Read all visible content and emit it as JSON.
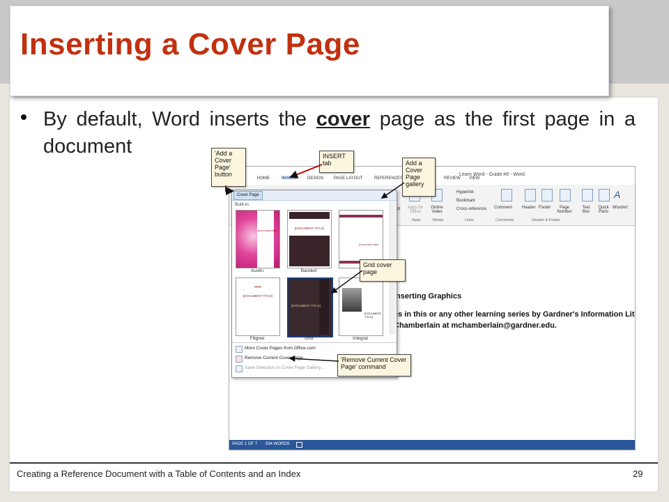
{
  "slide": {
    "title": "Inserting a Cover Page",
    "bullet_before": "By default, Word inserts the ",
    "bullet_emph": "cover",
    "bullet_after": " page as the first page in a document",
    "footer_text": "Creating a Reference Document with a Table of Contents and an Index",
    "page_number": "29"
  },
  "word": {
    "doc_title": "Learn Word - Guide #9 - Word",
    "tabs": [
      "HOME",
      "INSERT",
      "DESIGN",
      "PAGE LAYOUT",
      "REFERENCES",
      "S",
      "REVIEW",
      "VIEW"
    ],
    "cover_button": "Cover Page",
    "builtin_label": "Built-in",
    "thumbnails": [
      "Austin",
      "Banded",
      "",
      "Filigree",
      "Grid",
      "Integral"
    ],
    "thumb_texts": {
      "austin": "[Document title]",
      "banded": "[DOCUMENT TITLE]",
      "third": "[Document title]",
      "filigree": "[DOCUMENT TITLE]",
      "grid": "[DOCUMENT TITLE]",
      "integral": "[DOCUMENT TITLE]"
    },
    "menu_items": [
      "More Cover Pages from Office.com",
      "Remove Current Cover Page",
      "Save Selection to Cover Page Gallery..."
    ],
    "ribbon": {
      "shot_label": "hot",
      "apps_label": "Apps for Office",
      "online_video_label": "Online Video",
      "hyperlink": "Hyperlink",
      "bookmark": "Bookmark",
      "cross_reference": "Cross-reference",
      "comment": "Comment",
      "header": "Header",
      "footer": "Footer",
      "page_number": "Page Number",
      "text_box": "Text Box",
      "quick_parts": "Quick Parts",
      "wordart": "WordArt",
      "groups": [
        "Apps",
        "Media",
        "Links",
        "Comments",
        "Header & Footer"
      ]
    },
    "doc_heading": "Inserting Graphics",
    "doc_line1": "es in this or any other learning series by Gardner's Information Lit",
    "doc_line2": "Chamberlain at mchamberlain@gardner.edu.",
    "status": {
      "page": "PAGE 1 OF 7",
      "words": "934 WORDS"
    }
  },
  "callouts": {
    "add_cover": "'Add a Cover Page' button",
    "insert_tab": "INSERT tab",
    "gallery": "Add a Cover Page gallery",
    "grid": "Grid cover page",
    "remove": "'Remove Current Cover Page' command"
  },
  "colors": {
    "title": "#c2300f",
    "word_blue": "#2b579a",
    "callout_bg": "#fdf6df"
  }
}
